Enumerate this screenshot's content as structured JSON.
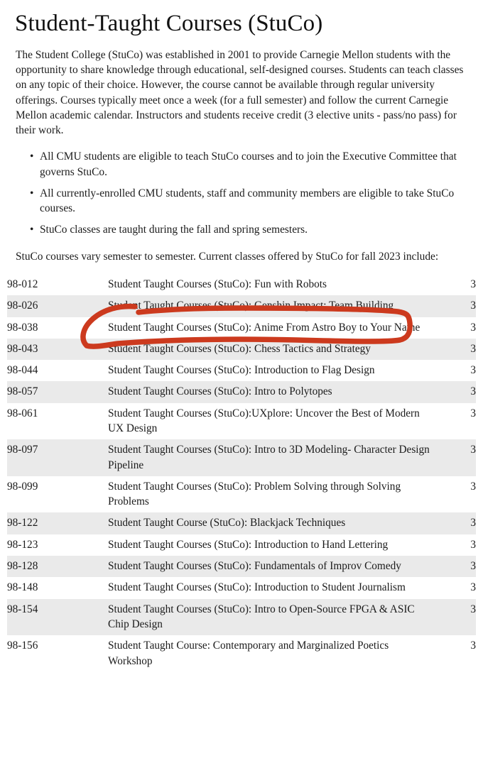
{
  "page": {
    "title": "Student-Taught Courses (StuCo)",
    "intro": "The Student College (StuCo) was established in 2001 to provide Carnegie Mellon students with the opportunity to share knowledge through educational, self-designed courses. Students can teach classes on any topic of their choice. However, the course cannot be available through regular university offerings. Courses typically meet once a week (for a full semester) and follow the current Carnegie Mellon academic calendar. Instructors and students receive credit (3 elective units - pass/no pass) for their work.",
    "lead_in": "StuCo courses vary semester to semester. Current classes offered by StuCo for fall 2023 include:"
  },
  "bullets": [
    {
      "marker": "•",
      "text": "All CMU students are eligible to teach StuCo courses and to join the Executive Committee that governs StuCo."
    },
    {
      "marker": "•",
      "text": "All currently-enrolled CMU students, staff and community members are eligible to take StuCo courses."
    },
    {
      "marker": "•",
      "text": "StuCo classes are taught during the fall and spring semesters."
    }
  ],
  "courses": [
    {
      "number": "98-012",
      "title": "Student Taught Courses (StuCo): Fun with Robots",
      "units": "3"
    },
    {
      "number": "98-026",
      "title": "Student Taught Courses (StuCo): Genshin Impact: Team Building",
      "units": "3"
    },
    {
      "number": "98-038",
      "title": "Student Taught Courses (StuCo): Anime From Astro Boy to Your Name",
      "units": "3"
    },
    {
      "number": "98-043",
      "title": "Student Taught Courses (StuCo): Chess Tactics and Strategy",
      "units": "3"
    },
    {
      "number": "98-044",
      "title": "Student Taught Courses (StuCo): Introduction to Flag Design",
      "units": "3"
    },
    {
      "number": "98-057",
      "title": "Student Taught Courses (StuCo): Intro to Polytopes",
      "units": "3"
    },
    {
      "number": "98-061",
      "title": "Student Taught Courses (StuCo):UXplore: Uncover the Best of Modern UX Design",
      "units": "3"
    },
    {
      "number": "98-097",
      "title": "Student Taught Courses (StuCo): Intro to 3D Modeling- Character Design Pipeline",
      "units": "3"
    },
    {
      "number": "98-099",
      "title": "Student Taught Courses (StuCo): Problem Solving through Solving Problems",
      "units": "3"
    },
    {
      "number": "98-122",
      "title": "Student Taught Course (StuCo): Blackjack Techniques",
      "units": "3"
    },
    {
      "number": "98-123",
      "title": "Student Taught Courses (StuCo): Introduction to Hand Lettering",
      "units": "3"
    },
    {
      "number": "98-128",
      "title": "Student Taught Courses (StuCo): Fundamentals of Improv Comedy",
      "units": "3"
    },
    {
      "number": "98-148",
      "title": "Student Taught Courses (StuCo): Introduction to Student Journalism",
      "units": "3"
    },
    {
      "number": "98-154",
      "title": "Student Taught Courses (StuCo): Intro to Open-Source FPGA & ASIC Chip Design",
      "units": "3"
    },
    {
      "number": "98-156",
      "title": "Student Taught Course: Contemporary and Marginalized Poetics Workshop",
      "units": "3"
    }
  ],
  "annotation": {
    "kind": "hand-drawn-ellipse-highlight",
    "targets_course_number": "98-026",
    "color": "#cc3a1e"
  },
  "colors": {
    "row_even_background": "#eaeaea",
    "row_odd_background": "#ffffff",
    "text": "#1b1b1b",
    "annotation_red": "#cc3a1e"
  }
}
